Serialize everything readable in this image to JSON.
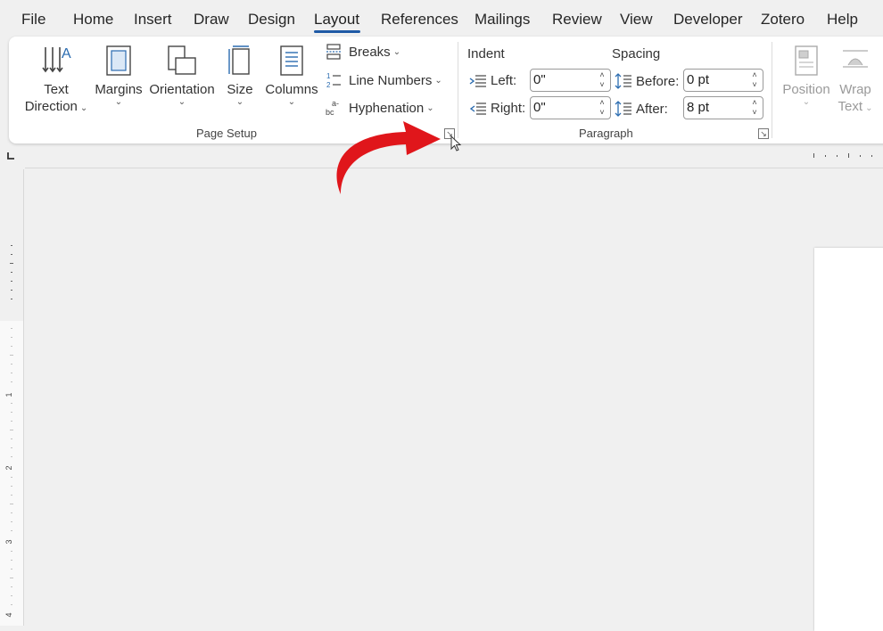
{
  "tabs": [
    {
      "label": "File"
    },
    {
      "label": "Home"
    },
    {
      "label": "Insert"
    },
    {
      "label": "Draw"
    },
    {
      "label": "Design"
    },
    {
      "label": "Layout",
      "active": true
    },
    {
      "label": "References"
    },
    {
      "label": "Mailings"
    },
    {
      "label": "Review"
    },
    {
      "label": "View"
    },
    {
      "label": "Developer"
    },
    {
      "label": "Zotero"
    },
    {
      "label": "Help"
    }
  ],
  "page_setup": {
    "text_direction": {
      "line1": "Text",
      "line2": "Direction"
    },
    "margins": "Margins",
    "orientation": "Orientation",
    "size": "Size",
    "columns": "Columns",
    "breaks": "Breaks",
    "line_numbers": "Line Numbers",
    "hyphenation": "Hyphenation",
    "group_label": "Page Setup"
  },
  "paragraph": {
    "indent_title": "Indent",
    "spacing_title": "Spacing",
    "left_label": "Left:",
    "left_value": "0\"",
    "right_label": "Right:",
    "right_value": "0\"",
    "before_label": "Before:",
    "before_value": "0 pt",
    "after_label": "After:",
    "after_value": "8 pt",
    "group_label": "Paragraph"
  },
  "arrange": {
    "position": "Position",
    "wrap_line1": "Wrap",
    "wrap_line2": "Text"
  },
  "ruler": {
    "v_numbers": [
      "1",
      "2",
      "3",
      "4"
    ]
  },
  "colors": {
    "accent": "#1f5aa6",
    "annotation_arrow": "#e0161b",
    "icon_blue": "#2b6cb0"
  }
}
